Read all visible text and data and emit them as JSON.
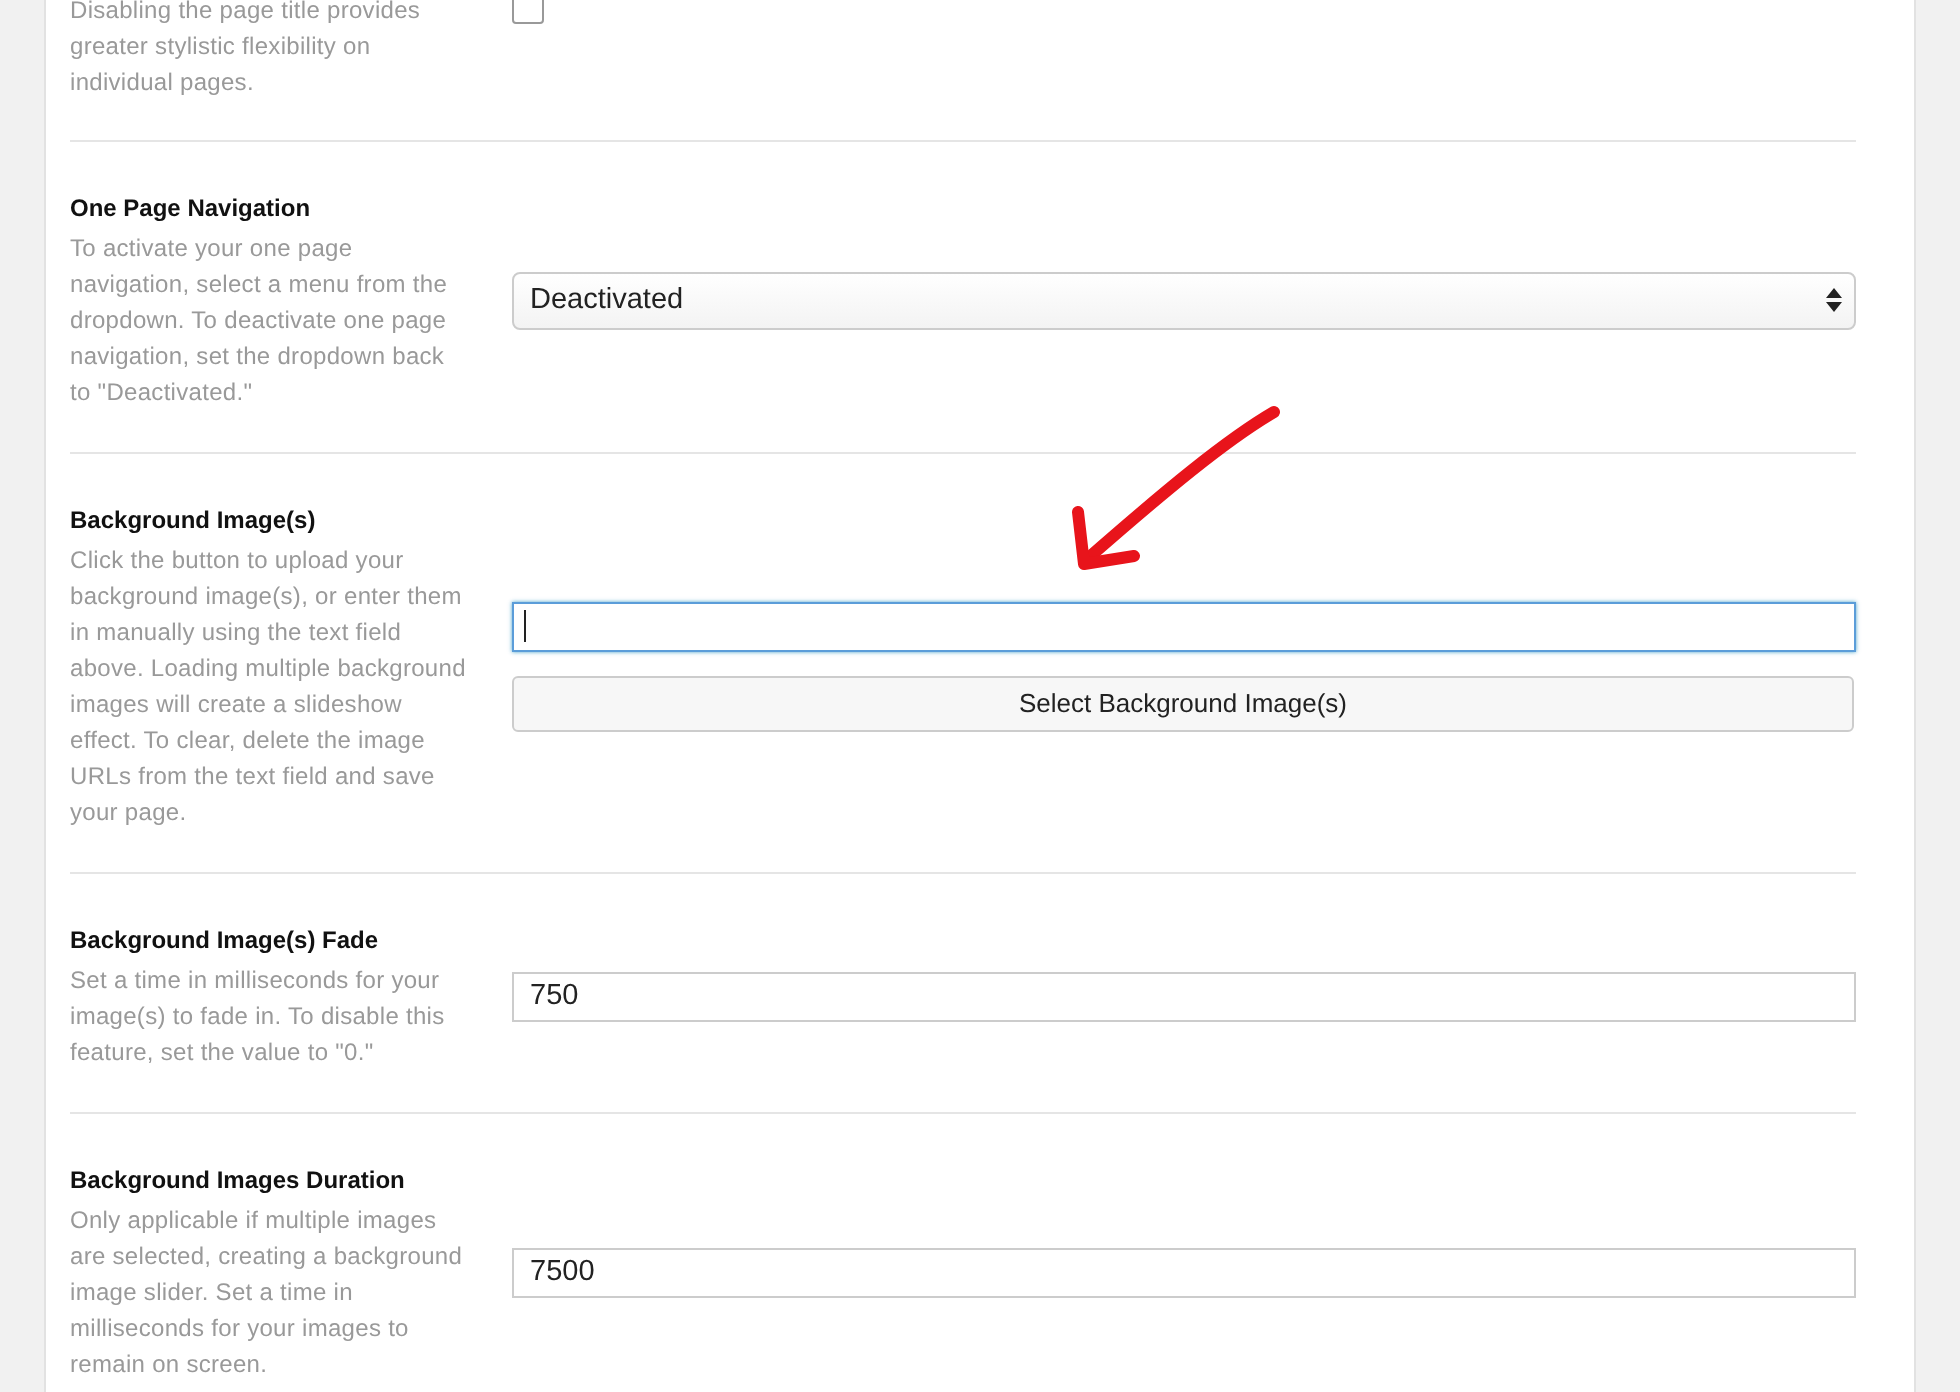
{
  "sections": [
    {
      "kind": "checkbox",
      "description": "Disabling the page title provides greater stylistic flexibility on individual pages.",
      "checked": false
    },
    {
      "kind": "select",
      "title": "One Page Navigation",
      "description": "To activate your one page navigation, select a menu from the dropdown. To deactivate one page navigation, set the dropdown back to \"Deactivated.\"",
      "value": "Deactivated"
    },
    {
      "kind": "upload",
      "title": "Background Image(s)",
      "description": "Click the button to upload your background image(s), or enter them in manually using the text field above. Loading multiple background images will create a slideshow effect. To clear, delete the image URLs from the text field and save your page.",
      "focused": true,
      "button": "Select Background Image(s)"
    },
    {
      "kind": "text",
      "title": "Background Image(s) Fade",
      "description": "Set a time in milliseconds for your image(s) to fade in. To disable this feature, set the value to \"0.\"",
      "value": "750"
    },
    {
      "kind": "text",
      "title": "Background Images Duration",
      "description": "Only applicable if multiple images are selected, creating a background image slider. Set a time in milliseconds for your images to remain on screen.",
      "value": "7500"
    }
  ]
}
